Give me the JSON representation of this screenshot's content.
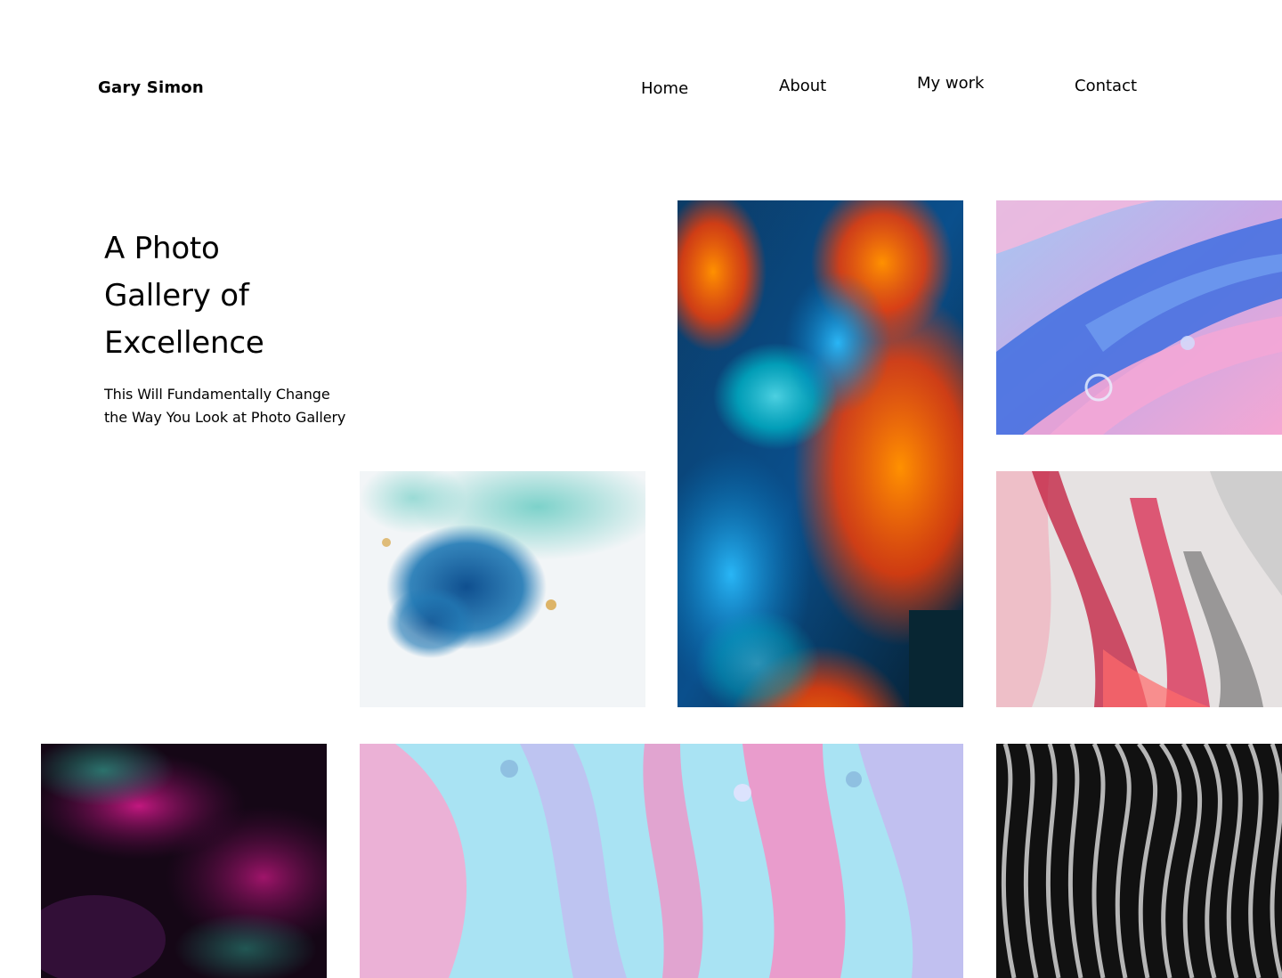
{
  "header": {
    "logo_text": "Gary Simon",
    "nav": [
      {
        "label": "Home"
      },
      {
        "label": "About"
      },
      {
        "label": "My work"
      },
      {
        "label": "Contact"
      }
    ]
  },
  "hero": {
    "title_lines": [
      "A Photo",
      "Gallery of",
      "Excellence"
    ],
    "subtitle": "This Will Fundamentally Change the Way You Look at Photo Gallery"
  },
  "gallery": {
    "tiles": [
      {
        "subject": "colorful-smoke-photo",
        "colors": [
          "#0a2a3a",
          "#1e88e5",
          "#ff5722",
          "#00bcd4"
        ]
      },
      {
        "subject": "blue-pink-fluid-art-photo",
        "colors": [
          "#4169e1",
          "#f3a6d6",
          "#9fc7f0"
        ]
      },
      {
        "subject": "teal-blue-splash-photo",
        "colors": [
          "#f4f6f8",
          "#1767a8",
          "#6cc7c1",
          "#d7a443"
        ]
      },
      {
        "subject": "red-gray-marble-photo",
        "colors": [
          "#e8e4e4",
          "#c2193b",
          "#7f7f7f"
        ]
      },
      {
        "subject": "purple-fractal-photo",
        "colors": [
          "#120616",
          "#8c0f75",
          "#2a8c7d"
        ]
      },
      {
        "subject": "pastel-fluid-art-photo",
        "colors": [
          "#a9e3f3",
          "#f48fc4",
          "#c7b6ef"
        ]
      },
      {
        "subject": "monochrome-wave-photo",
        "colors": [
          "#0d0d0d",
          "#bdbdbd",
          "#5a5a5a"
        ]
      }
    ]
  }
}
